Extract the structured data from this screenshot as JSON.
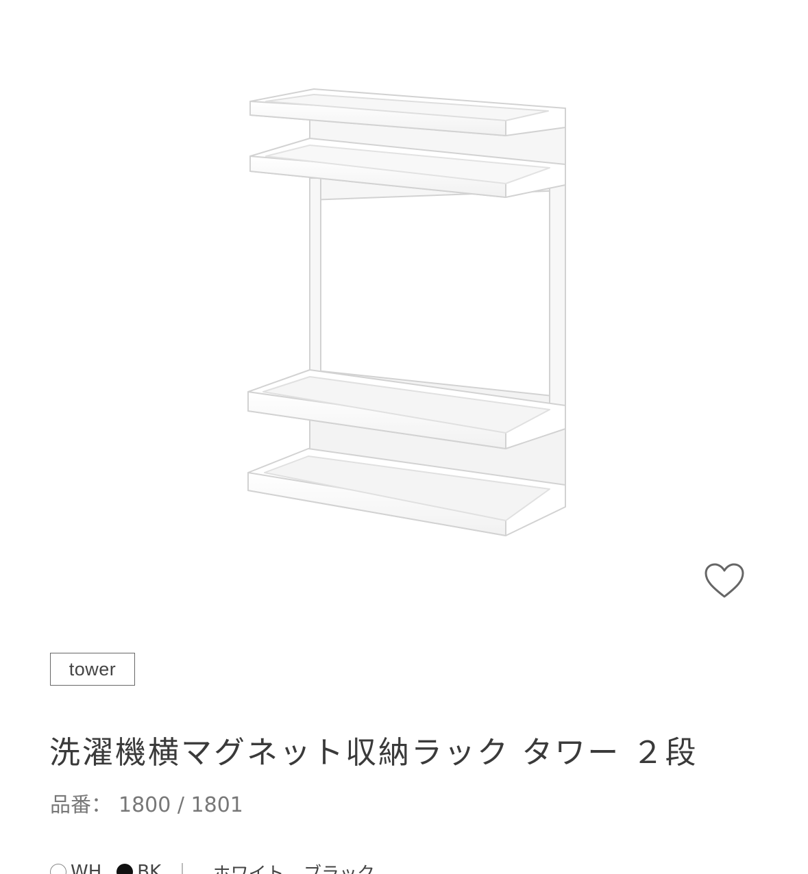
{
  "product": {
    "brand": "tower",
    "title": "洗濯機横マグネット収納ラック タワー ２段",
    "code_label": "品番：",
    "code_value": "1800 / 1801"
  },
  "colors": {
    "swatches": [
      {
        "code": "WH",
        "color": "#ffffff"
      },
      {
        "code": "BK",
        "color": "#111111"
      }
    ],
    "names": [
      "ホワイト",
      "ブラック"
    ]
  },
  "icons": {
    "favorite": "heart-outline-icon"
  },
  "theme": {
    "text": "#3a3a3a",
    "muted": "#777777",
    "border": "#666666"
  }
}
